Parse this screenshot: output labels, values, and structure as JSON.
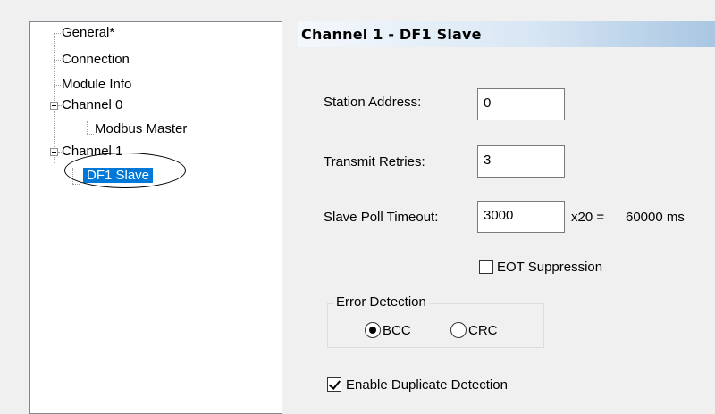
{
  "tree": {
    "items": [
      {
        "label": "General*"
      },
      {
        "label": "Connection"
      },
      {
        "label": "Module Info"
      },
      {
        "label": "Channel 0"
      },
      {
        "label": "Modbus Master"
      },
      {
        "label": "Channel 1"
      },
      {
        "label": "DF1 Slave"
      }
    ],
    "selected": "DF1 Slave"
  },
  "panel": {
    "title": "Channel 1 - DF1 Slave",
    "station_address": {
      "label": "Station Address:",
      "value": "0"
    },
    "transmit_retries": {
      "label": "Transmit Retries:",
      "value": "3"
    },
    "slave_poll_timeout": {
      "label": "Slave Poll Timeout:",
      "value": "3000",
      "multiplier": "x20 =",
      "result": "60000 ms"
    },
    "eot_suppression": {
      "label": "EOT Suppression",
      "checked": false
    },
    "error_detection": {
      "title": "Error Detection",
      "options": [
        {
          "label": "BCC",
          "selected": true
        },
        {
          "label": "CRC",
          "selected": false
        }
      ]
    },
    "duplicate_detection": {
      "label": "Enable Duplicate Detection",
      "checked": true
    }
  },
  "colors": {
    "selection": "#0078d7",
    "header_gradient_end": "#a9c6e2"
  }
}
